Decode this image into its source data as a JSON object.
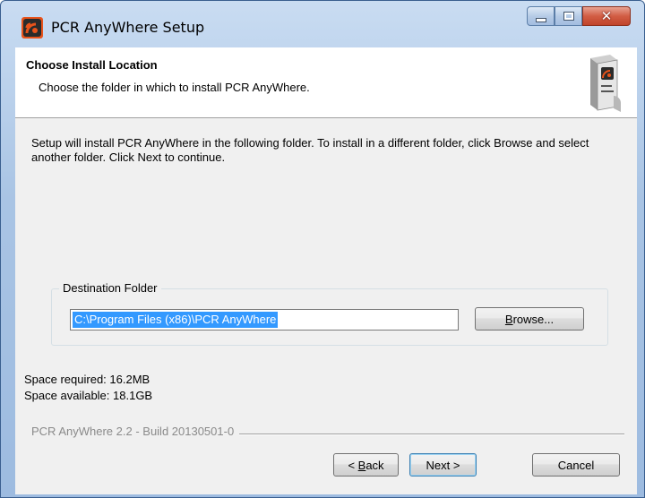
{
  "window": {
    "title": "PCR AnyWhere Setup"
  },
  "header": {
    "title": "Choose Install Location",
    "subtitle": "Choose the folder in which to install PCR AnyWhere."
  },
  "body": {
    "description": "Setup will install PCR AnyWhere in the following folder. To install in a different folder, click Browse and select another folder. Click Next to continue.",
    "destination_label": "Destination Folder",
    "destination_path": "C:\\Program Files (x86)\\PCR AnyWhere",
    "browse_prefix": "B",
    "browse_rest": "rowse...",
    "space_required": "Space required: 16.2MB",
    "space_available": "Space available: 18.1GB"
  },
  "footer": {
    "branding": "PCR AnyWhere 2.2 - Build 20130501-0",
    "back_arrow": "< ",
    "back_hotkey": "B",
    "back_rest": "ack",
    "next_label": "Next >",
    "cancel_label": "Cancel"
  },
  "colors": {
    "selection": "#3399ff",
    "accent": "#e8531b"
  },
  "icons": {
    "app": "app-logo-icon",
    "product_box": "product-box-icon"
  }
}
